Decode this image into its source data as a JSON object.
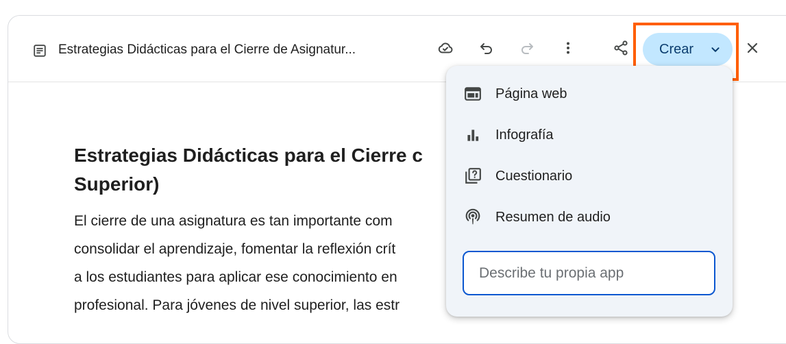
{
  "toolbar": {
    "doc_title": "Estrategias Didácticas para el Cierre de Asignatur...",
    "crear_label": "Crear",
    "icons": [
      "document-icon",
      "cloud-sync-icon",
      "undo-icon",
      "redo-icon",
      "more-vert-icon",
      "share-icon",
      "chevron-down-icon",
      "close-icon"
    ]
  },
  "document": {
    "heading_lines": [
      "Estrategias Didácticas para el Cierre c",
      "Superior)"
    ],
    "paragraph_lines": [
      "El cierre de una asignatura es tan importante com",
      "consolidar el aprendizaje, fomentar la reflexión crít",
      "a los estudiantes para aplicar ese conocimiento en",
      "profesional. Para jóvenes de nivel superior, las estr"
    ]
  },
  "create_menu": {
    "items": [
      {
        "label": "Página web",
        "icon": "web-page-icon"
      },
      {
        "label": "Infografía",
        "icon": "bar-chart-icon"
      },
      {
        "label": "Cuestionario",
        "icon": "quiz-icon"
      },
      {
        "label": "Resumen de audio",
        "icon": "podcast-icon"
      }
    ],
    "prompt_placeholder": "Describe tu propia app"
  },
  "colors": {
    "crear_button_bg": "#c2e7ff",
    "highlight_border": "#ff5e00",
    "menu_bg": "#f0f4f9",
    "prompt_border": "#0b57d0"
  }
}
